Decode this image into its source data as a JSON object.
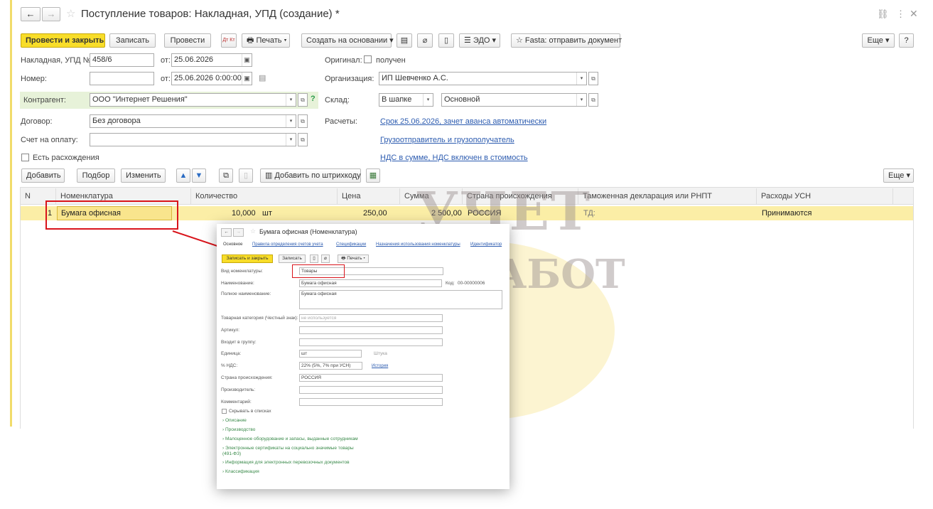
{
  "window": {
    "title": "Поступление товаров: Накладная, УПД (создание) *",
    "back": "←",
    "forward": "→"
  },
  "toolbar": {
    "post_close": "Провести и закрыть",
    "save": "Записать",
    "post": "Провести",
    "dtkt": "Дт Кт",
    "print": "Печать",
    "create_based": "Создать на основании",
    "edo": "ЭДО",
    "fasta": "Fasta: отправить документ",
    "more": "Еще",
    "help": "?"
  },
  "form": {
    "invoice_label": "Накладная, УПД №:",
    "invoice_no": "458/6",
    "from1": "от:",
    "date1": "25.06.2026",
    "number_label": "Номер:",
    "number_value": "",
    "from2": "от:",
    "date2": "25.06.2026  0:00:00",
    "contractor_label": "Контрагент:",
    "contractor": "ООО \"Интернет Решения\"",
    "contract_label": "Договор:",
    "contract": "Без договора",
    "payment_label": "Счет на оплату:",
    "payment": "",
    "discrepancy": "Есть расхождения",
    "original_label": "Оригинал:",
    "original_value": "получен",
    "org_label": "Организация:",
    "org": "ИП Шевченко А.С.",
    "warehouse_label": "Склад:",
    "warehouse_mode": "В шапке",
    "warehouse": "Основной",
    "settlements_label": "Расчеты:",
    "settlements_link": "Срок 25.06.2026, зачет аванса автоматически",
    "shipper_link": "Грузоотправитель и грузополучатель",
    "vat_link": "НДС в сумме, НДС включен в стоимость"
  },
  "table_toolbar": {
    "add": "Добавить",
    "select": "Подбор",
    "change": "Изменить",
    "barcode": "Добавить по штрихкоду",
    "more": "Еще"
  },
  "table": {
    "headers": [
      "N",
      "Номенклатура",
      "Количество",
      "Цена",
      "Сумма",
      "Страна происхождения",
      "Таможенная декларация или РНПТ",
      "Расходы УСН"
    ],
    "rows": [
      {
        "n": "1",
        "item": "Бумага офисная",
        "qty": "10,000",
        "unit": "шт",
        "price": "250,00",
        "sum": "2 500,00",
        "country": "РОССИЯ",
        "customs": "ТД:",
        "usn": "Принимаются"
      }
    ]
  },
  "popup": {
    "title": "Бумага офисная (Номенклатура)",
    "tabs": [
      "Основное",
      "Правила определения счетов учета",
      "Спецификации",
      "Назначения использования номенклатуры",
      "Идентификатор"
    ],
    "save_close": "Записать и закрыть",
    "save": "Записать",
    "print": "Печать",
    "fields": {
      "type_label": "Вид номенклатуры:",
      "type": "Товары",
      "name_label": "Наименование:",
      "name": "Бумага офисная",
      "code_label": "Код:",
      "code": "00-00000006",
      "full_label": "Полное наименование:",
      "full": "Бумага офисная",
      "category_label": "Товарная категория (Честный знак):",
      "category": "не используется",
      "article_label": "Артикул:",
      "group_label": "Входит в группу:",
      "unit_label": "Единица:",
      "unit": "шт",
      "unit_name": "Штука",
      "vat_label": "% НДС:",
      "vat": "22% (5%, 7% при УСН)",
      "history": "История",
      "country_label": "Страна происхождения:",
      "country": "РОССИЯ",
      "maker_label": "Производитель:",
      "comment_label": "Комментарий:",
      "hide": "Скрывать в списках"
    },
    "sections": [
      "Описание",
      "Производство",
      "Малоценное оборудование и запасы, выданные сотрудникам",
      "Электронные сертификаты на социально значимые товары (491-ФЗ)",
      "Информация для электронных перевозочных документов",
      "Классификация"
    ]
  },
  "watermark": {
    "line1": "УЧЕТ",
    "line2": "БЕЗ ЗАБОТ"
  },
  "colors": {
    "primary": "#f8dd29",
    "link": "#2d5cb0",
    "highlight_row": "#fbeea6",
    "callout": "#d9141b",
    "contractor_bg": "#e7f2d9"
  }
}
